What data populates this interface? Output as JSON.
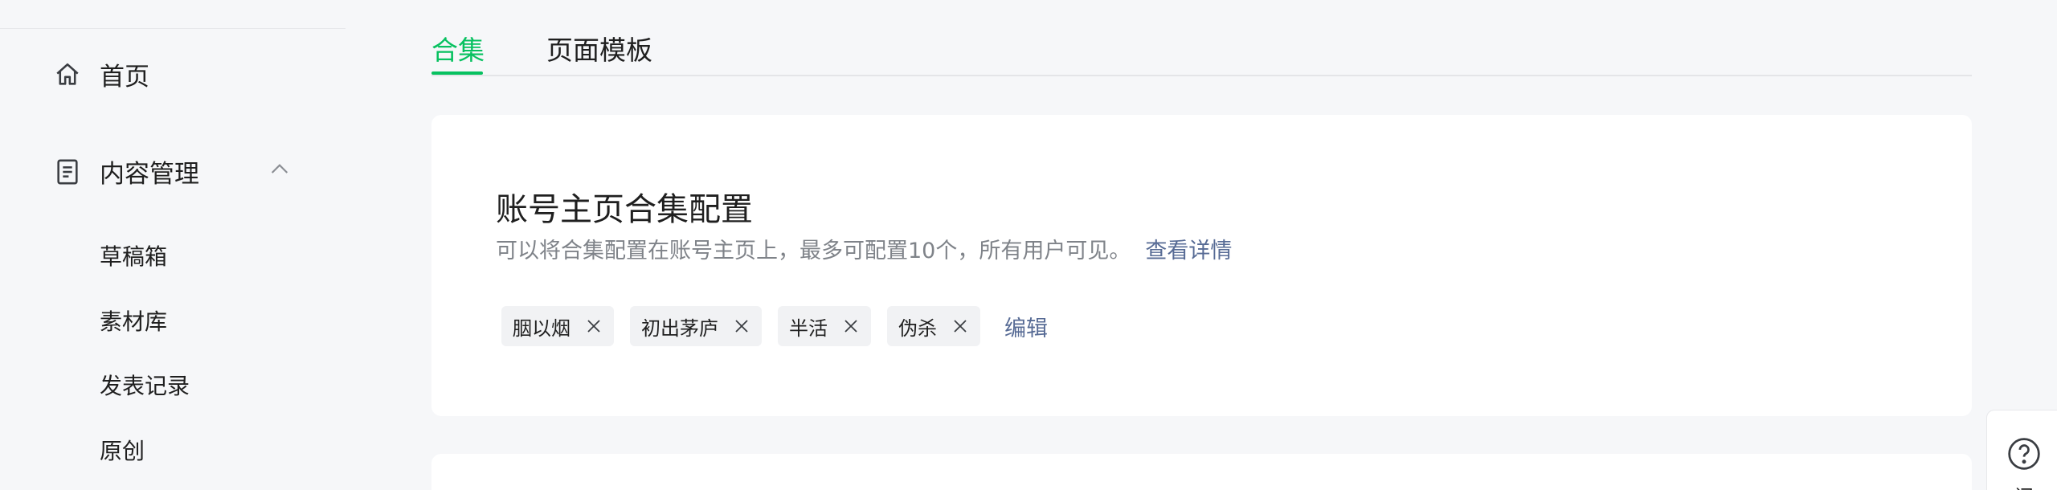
{
  "sidebar": {
    "home": {
      "label": "首页",
      "icon": "home-icon"
    },
    "content": {
      "label": "内容管理",
      "icon": "document-icon",
      "expanded": true
    },
    "sub_items": [
      "草稿箱",
      "素材库",
      "发表记录",
      "原创"
    ]
  },
  "tabs": [
    {
      "label": "合集",
      "active": true
    },
    {
      "label": "页面模板",
      "active": false
    }
  ],
  "card": {
    "title": "账号主页合集配置",
    "description": "可以将合集配置在账号主页上，最多可配置10个，所有用户可见。",
    "link": "查看详情",
    "tags": [
      "胭以烟",
      "初出茅庐",
      "半活",
      "伪杀"
    ],
    "edit": "编辑"
  },
  "help": {
    "icon": "question-icon",
    "label_partial": "问"
  },
  "colors": {
    "accent": "#07c160",
    "link": "#576b95",
    "muted": "#7f8389"
  }
}
